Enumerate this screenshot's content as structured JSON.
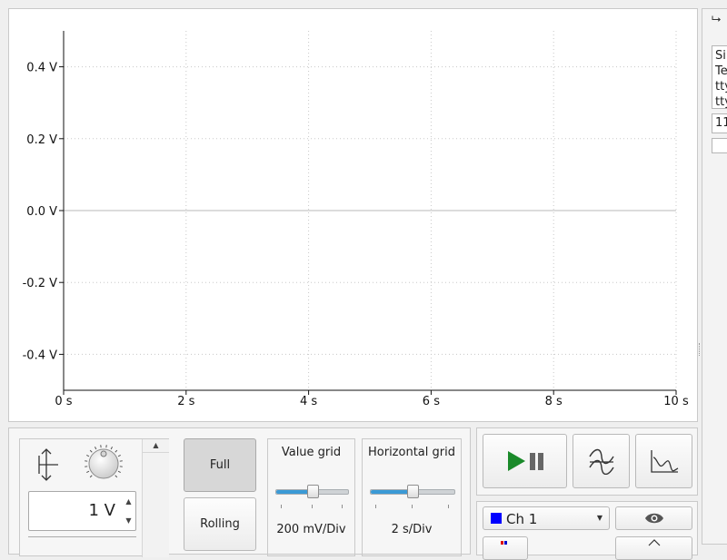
{
  "chart_data": {
    "type": "line",
    "title": "",
    "xlabel": "",
    "ylabel": "",
    "xlim": [
      0,
      10
    ],
    "ylim": [
      -0.5,
      0.5
    ],
    "x_ticks": [
      0,
      2,
      4,
      6,
      8,
      10
    ],
    "x_tick_labels": [
      "0 s",
      "2 s",
      "4 s",
      "6 s",
      "8 s",
      "10 s"
    ],
    "y_ticks": [
      0.4,
      0.2,
      0.0,
      -0.2,
      -0.4
    ],
    "y_tick_labels": [
      "0.4 V",
      "0.2 V",
      "0.0 V",
      "-0.2 V",
      "-0.4 V"
    ],
    "grid": true,
    "series": []
  },
  "scale": {
    "value": "1 V"
  },
  "mode": {
    "full_label": "Full",
    "rolling_label": "Rolling",
    "active": "Full"
  },
  "value_grid": {
    "title": "Value grid",
    "readout": "200 mV/Div",
    "level": 0.5
  },
  "horizontal_grid": {
    "title": "Horizontal grid",
    "readout": "2 s/Div",
    "level": 0.5
  },
  "channel": {
    "selected": "Ch 1",
    "color": "#0000ff"
  },
  "side_panel": {
    "lines": [
      "Si",
      "Te",
      "tty",
      "tty"
    ],
    "field_value": "11"
  },
  "colors": {
    "play": "#1a8a2a",
    "slider_fill": "#3a9ad6"
  }
}
